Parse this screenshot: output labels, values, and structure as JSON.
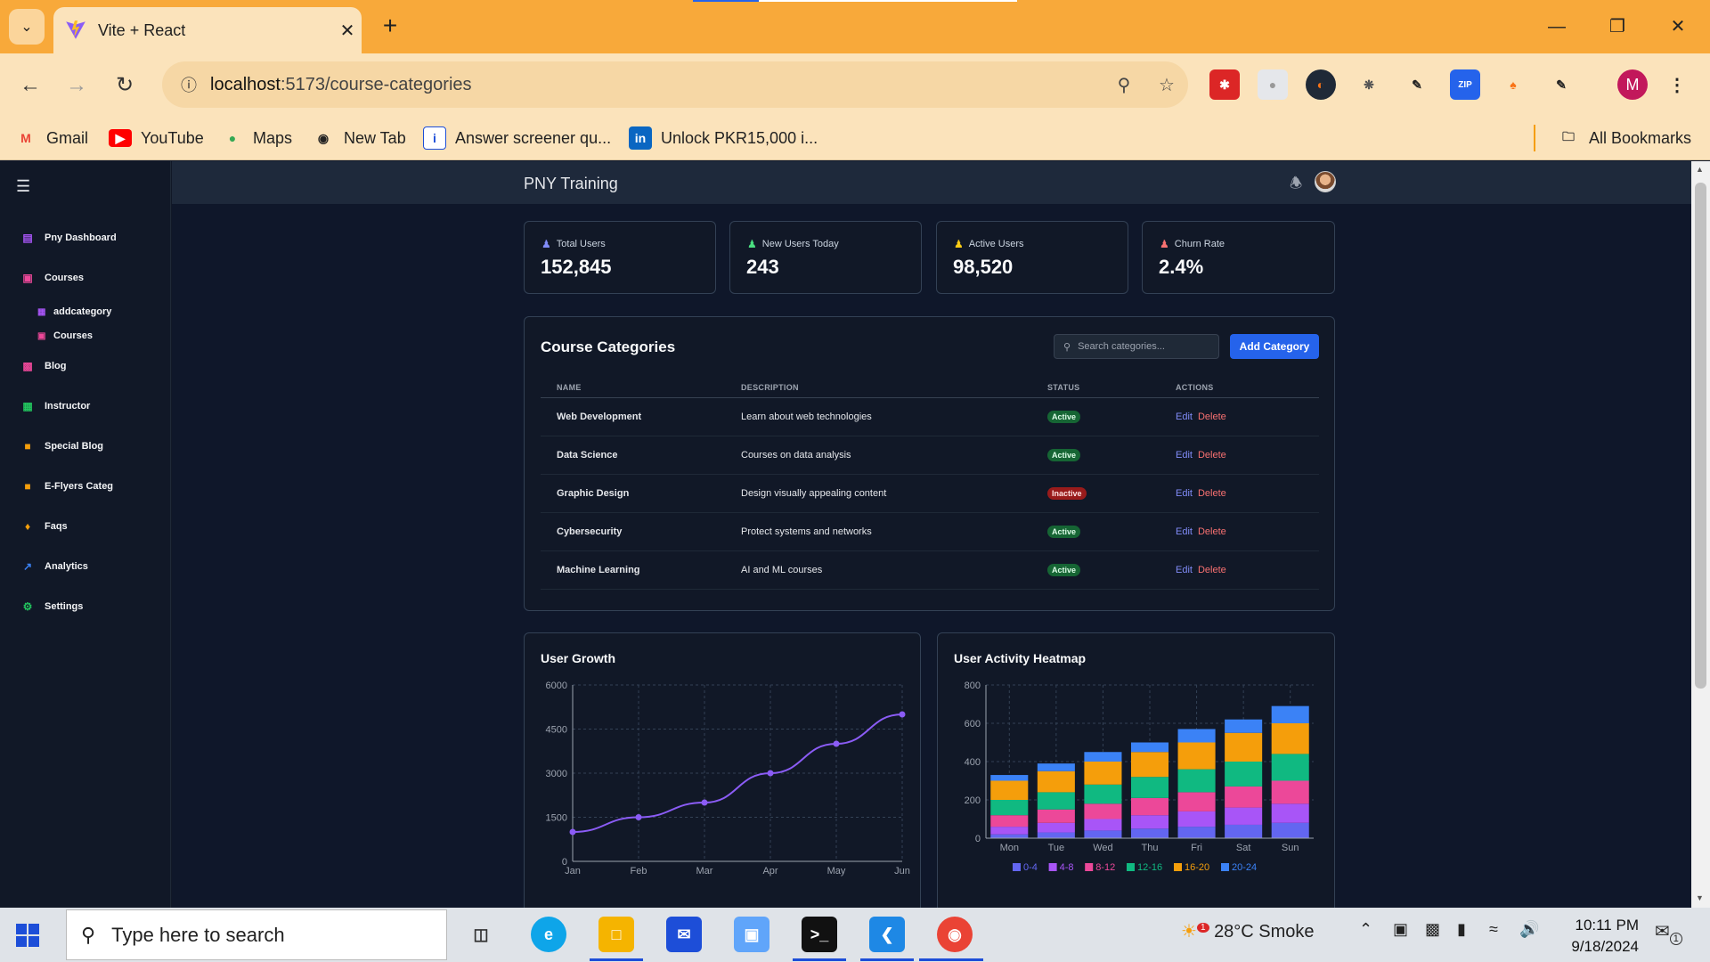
{
  "browser": {
    "tab_title": "Vite + React",
    "url_host": "localhost",
    "url_path": ":5173/course-categories",
    "bookmarks": [
      {
        "label": "Gmail",
        "icon": "gmail-icon"
      },
      {
        "label": "YouTube",
        "icon": "youtube-icon"
      },
      {
        "label": "Maps",
        "icon": "maps-icon"
      },
      {
        "label": "New Tab",
        "icon": "globe-icon"
      },
      {
        "label": "Answer screener qu...",
        "icon": "info-icon"
      },
      {
        "label": "Unlock PKR15,000 i...",
        "icon": "linkedin-icon"
      }
    ],
    "all_bookmarks": "All Bookmarks",
    "profile_initial": "M",
    "ext_zip": "ZIP"
  },
  "app": {
    "brand": "PNY Training",
    "sidebar": {
      "items": [
        {
          "label": "Pny Dashboard",
          "icon": "bar-chart-icon",
          "color": "#a855f7"
        },
        {
          "label": "Courses",
          "icon": "book-icon",
          "color": "#ec4899"
        },
        {
          "label": "Blog",
          "icon": "chart-icon",
          "color": "#ec4899"
        },
        {
          "label": "Instructor",
          "icon": "table-icon",
          "color": "#22c55e"
        },
        {
          "label": "Special Blog",
          "icon": "folder-icon",
          "color": "#f59e0b"
        },
        {
          "label": "E-Flyers Categ",
          "icon": "folder-icon",
          "color": "#f59e0b"
        },
        {
          "label": "Faqs",
          "icon": "bell-icon",
          "color": "#f59e0b"
        },
        {
          "label": "Analytics",
          "icon": "trend-icon",
          "color": "#3b82f6"
        },
        {
          "label": "Settings",
          "icon": "gear-icon",
          "color": "#22c55e"
        }
      ],
      "sub_items": [
        {
          "label": "addcategory"
        },
        {
          "label": "Courses"
        }
      ]
    },
    "stats": [
      {
        "label": "Total Users",
        "value": "152,845",
        "color": "#818cf8"
      },
      {
        "label": "New Users Today",
        "value": "243",
        "color": "#4ade80"
      },
      {
        "label": "Active Users",
        "value": "98,520",
        "color": "#facc15"
      },
      {
        "label": "Churn Rate",
        "value": "2.4%",
        "color": "#f87171"
      }
    ],
    "categories": {
      "title": "Course Categories",
      "search_placeholder": "Search categories...",
      "add_button": "Add Category",
      "columns": [
        "NAME",
        "DESCRIPTION",
        "STATUS",
        "ACTIONS"
      ],
      "rows": [
        {
          "name": "Web Development",
          "description": "Learn about web technologies",
          "status": "Active"
        },
        {
          "name": "Data Science",
          "description": "Courses on data analysis",
          "status": "Active"
        },
        {
          "name": "Graphic Design",
          "description": "Design visually appealing content",
          "status": "Inactive"
        },
        {
          "name": "Cybersecurity",
          "description": "Protect systems and networks",
          "status": "Active"
        },
        {
          "name": "Machine Learning",
          "description": "AI and ML courses",
          "status": "Active"
        }
      ],
      "edit_label": "Edit",
      "delete_label": "Delete"
    },
    "user_growth_title": "User Growth",
    "heatmap_title": "User Activity Heatmap"
  },
  "chart_data": [
    {
      "type": "line",
      "title": "User Growth",
      "x": [
        "Jan",
        "Feb",
        "Mar",
        "Apr",
        "May",
        "Jun"
      ],
      "series": [
        {
          "color": "#8b5cf6",
          "values": [
            1000,
            1500,
            2000,
            3000,
            4000,
            5000
          ]
        }
      ],
      "yticks": [
        0,
        1500,
        3000,
        4500,
        6000
      ],
      "ylim": [
        0,
        6000
      ],
      "grid": true
    },
    {
      "type": "bar",
      "stacked": true,
      "title": "User Activity Heatmap",
      "categories": [
        "Mon",
        "Tue",
        "Wed",
        "Thu",
        "Fri",
        "Sat",
        "Sun"
      ],
      "series": [
        {
          "name": "0-4",
          "color": "#6366f1",
          "values": [
            20,
            30,
            40,
            50,
            60,
            70,
            80
          ]
        },
        {
          "name": "4-8",
          "color": "#a855f7",
          "values": [
            40,
            50,
            60,
            70,
            80,
            90,
            100
          ]
        },
        {
          "name": "8-12",
          "color": "#ec4899",
          "values": [
            60,
            70,
            80,
            90,
            100,
            110,
            120
          ]
        },
        {
          "name": "12-16",
          "color": "#10b981",
          "values": [
            80,
            90,
            100,
            110,
            120,
            130,
            140
          ]
        },
        {
          "name": "16-20",
          "color": "#f59e0b",
          "values": [
            100,
            110,
            120,
            130,
            140,
            150,
            160
          ]
        },
        {
          "name": "20-24",
          "color": "#3b82f6",
          "values": [
            30,
            40,
            50,
            50,
            70,
            70,
            90
          ]
        }
      ],
      "yticks": [
        0,
        200,
        400,
        600,
        800
      ],
      "ylim": [
        0,
        800
      ],
      "legend": "bottom",
      "grid": true
    }
  ],
  "taskbar": {
    "search_placeholder": "Type here to search",
    "weather": "28°C  Smoke",
    "weather_badge": "1",
    "time": "10:11 PM",
    "date": "9/18/2024",
    "notification_count": "1"
  }
}
